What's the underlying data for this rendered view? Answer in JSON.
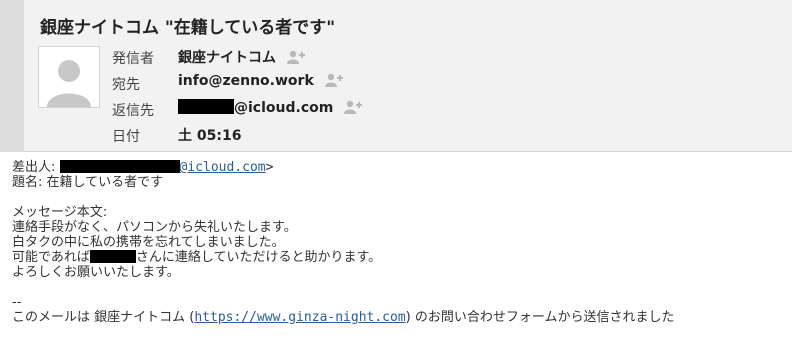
{
  "header": {
    "subject": "銀座ナイトコム \"在籍している者です\"",
    "from_label": "発信者",
    "from_value": "銀座ナイトコム",
    "to_label": "宛先",
    "to_value": "info@zenno.work",
    "reply_label": "返信先",
    "reply_value_suffix": "@icloud.com",
    "date_label": "日付",
    "date_value": "土 05:16"
  },
  "body": {
    "sender_label": "差出人: ",
    "sender_email_suffix": "@icloud.com",
    "sender_close": ">",
    "subject_line": "題名: 在籍している者です",
    "message_label": "メッセージ本文:",
    "line1": "連絡手段がなく、パソコンから失礼いたします。",
    "line2": "白タクの中に私の携帯を忘れてしまいました。",
    "line3_prefix": "可能であれば",
    "line3_suffix": "さんに連絡していただけると助かります。",
    "line4": "よろしくお願いいたします。",
    "separator": "--",
    "footer_prefix": "このメールは 銀座ナイトコム (",
    "footer_link": "https://www.ginza-night.com",
    "footer_suffix": ") のお問い合わせフォームから送信されました"
  },
  "colors": {
    "link": "#2a5d9c",
    "header_bg": "#f2f2f2",
    "redaction": "#000000"
  }
}
